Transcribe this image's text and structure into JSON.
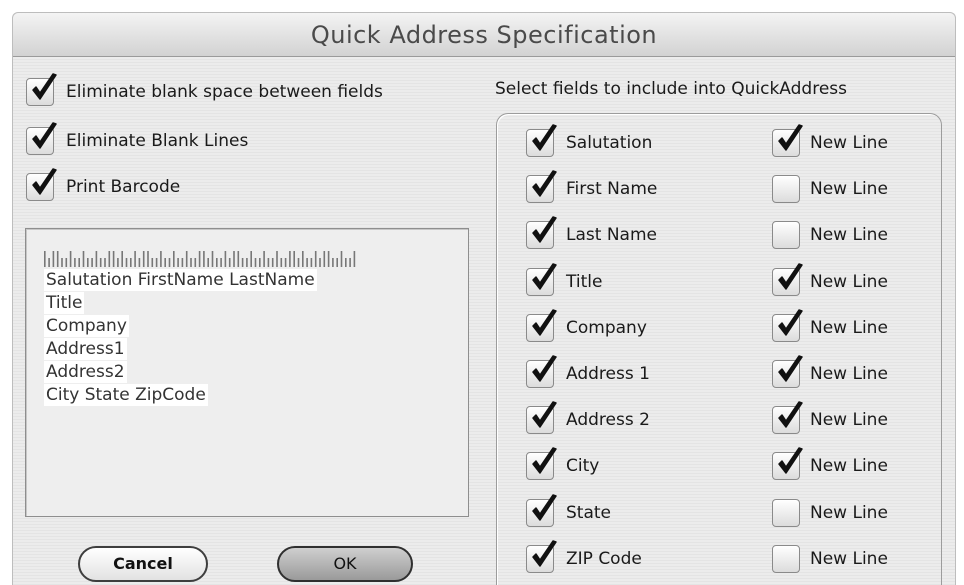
{
  "dialog": {
    "title": "Quick Address Specification"
  },
  "options": [
    {
      "label": "Eliminate blank space between fields",
      "checked": true
    },
    {
      "label": "Eliminate Blank Lines",
      "checked": true
    },
    {
      "label": "Print Barcode",
      "checked": true
    }
  ],
  "preview": {
    "lines": [
      "Salutation FirstName LastName",
      "Title",
      "Company",
      "Address1",
      "Address2",
      "City State ZipCode"
    ]
  },
  "buttons": {
    "cancel": "Cancel",
    "ok": "OK"
  },
  "fields_group": {
    "title": "Select fields to include into QuickAddress",
    "fields": [
      {
        "label": "Salutation",
        "include": true,
        "new_line_label": "New Line",
        "new_line": true
      },
      {
        "label": "First Name",
        "include": true,
        "new_line_label": "New Line",
        "new_line": false
      },
      {
        "label": "Last Name",
        "include": true,
        "new_line_label": "New Line",
        "new_line": false
      },
      {
        "label": "Title",
        "include": true,
        "new_line_label": "New Line",
        "new_line": true
      },
      {
        "label": "Company",
        "include": true,
        "new_line_label": "New Line",
        "new_line": true
      },
      {
        "label": "Address 1",
        "include": true,
        "new_line_label": "New Line",
        "new_line": true
      },
      {
        "label": "Address 2",
        "include": true,
        "new_line_label": "New Line",
        "new_line": true
      },
      {
        "label": "City",
        "include": true,
        "new_line_label": "New Line",
        "new_line": true
      },
      {
        "label": "State",
        "include": true,
        "new_line_label": "New Line",
        "new_line": false
      },
      {
        "label": "ZIP Code",
        "include": true,
        "new_line_label": "New Line",
        "new_line": false
      }
    ]
  }
}
